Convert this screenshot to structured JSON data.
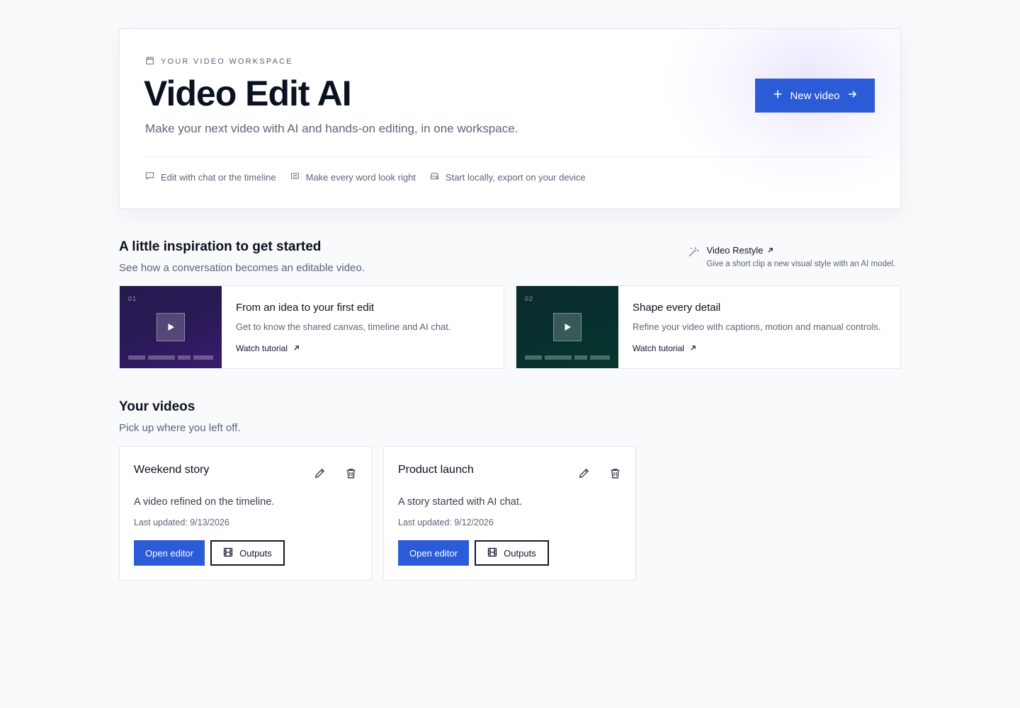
{
  "hero": {
    "eyebrow": "YOUR VIDEO WORKSPACE",
    "title": "Video Edit AI",
    "subtitle": "Make your next video with AI and hands-on editing, in one workspace.",
    "new_button": "New video",
    "features": [
      {
        "icon": "chat-bubble-icon",
        "label": "Edit with chat or the timeline"
      },
      {
        "icon": "caption-icon",
        "label": "Make every word look right"
      },
      {
        "icon": "drive-icon",
        "label": "Start locally, export on your device"
      }
    ]
  },
  "inspiration": {
    "title": "A little inspiration to get started",
    "subtitle": "See how a conversation becomes an editable video.",
    "restyle": {
      "icon": "magic-wand-icon",
      "title": "Video Restyle",
      "description": "Give a short clip a new visual style with an AI model."
    },
    "tutorials": [
      {
        "number": "01",
        "title": "From an idea to your first edit",
        "description": "Get to know the shared canvas, timeline and AI chat.",
        "link": "Watch tutorial"
      },
      {
        "number": "02",
        "title": "Shape every detail",
        "description": "Refine your video with captions, motion and manual controls.",
        "link": "Watch tutorial"
      }
    ]
  },
  "videos": {
    "title": "Your videos",
    "subtitle": "Pick up where you left off.",
    "items": [
      {
        "title": "Weekend story",
        "description": "A video refined on the timeline.",
        "updated": "Last updated: 9/13/2026",
        "open_label": "Open editor",
        "outputs_label": "Outputs"
      },
      {
        "title": "Product launch",
        "description": "A story started with AI chat.",
        "updated": "Last updated: 9/12/2026",
        "open_label": "Open editor",
        "outputs_label": "Outputs"
      }
    ]
  },
  "colors": {
    "accent": "#2b5bd7",
    "text": "#0b1120",
    "muted": "#5b6577",
    "background": "#f9fafc"
  }
}
